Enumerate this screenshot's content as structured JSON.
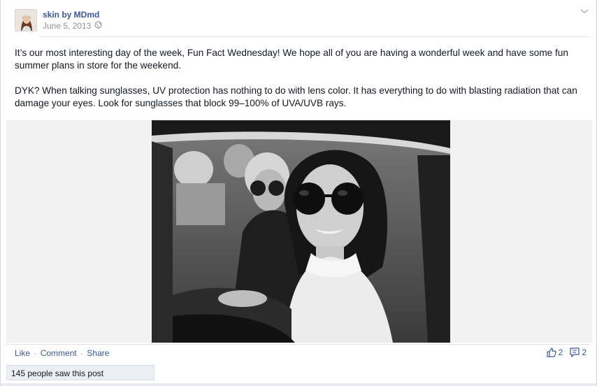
{
  "post": {
    "page_name": "skin by MDmd",
    "date": "June 5, 2013",
    "paragraphs": [
      "It’s our most interesting day of the week, Fun Fact Wednesday! We hope all of you are having a wonderful week and have some fun summer plans in store for the weekend.",
      "DYK? When talking sunglasses, UV protection has nothing to do with lens color. It has everything to do with blasting radiation that can damage your eyes. Look for sunglasses that block 99–100% of UVA/UVB rays."
    ]
  },
  "actions": {
    "like": "Like",
    "separator": "·",
    "comment": "Comment",
    "share": "Share"
  },
  "counts": {
    "likes": "2",
    "comments": "2"
  },
  "reach": {
    "text": "145 people saw this post"
  },
  "icons": {
    "audience": "globe-icon",
    "menu": "chevron-down-icon",
    "like_count": "thumbs-up-icon",
    "comment_count": "comment-icon"
  },
  "colors": {
    "link": "#3b5998",
    "meta": "#90949c",
    "reach_bg": "#edeff4"
  }
}
